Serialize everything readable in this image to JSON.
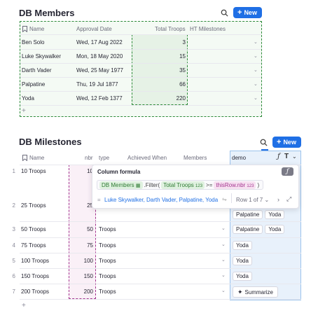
{
  "members": {
    "title": "DB Members",
    "new_label": "New",
    "columns": [
      "Name",
      "Approval Date",
      "Total Troops",
      "HT Milestones"
    ],
    "rows": [
      {
        "name": "Ben Solo",
        "date": "Wed, 17 Aug 2022",
        "troops": "3"
      },
      {
        "name": "Luke Skywalker",
        "date": "Mon, 18 May 2020",
        "troops": "15"
      },
      {
        "name": "Darth Vader",
        "date": "Wed, 25 May 1977",
        "troops": "35"
      },
      {
        "name": "Palpatine",
        "date": "Thu, 19 Jul 1877",
        "troops": "66"
      },
      {
        "name": "Yoda",
        "date": "Wed, 12 Feb 1377",
        "troops": "220"
      }
    ],
    "add_row": "+"
  },
  "milestones": {
    "title": "DB Milestones",
    "new_label": "New",
    "columns": [
      "Name",
      "nbr",
      "type",
      "Achieved When",
      "Members",
      "demo"
    ],
    "rows": [
      {
        "num": "1",
        "name": "10 Troops",
        "nbr": "10",
        "type": "",
        "demo": []
      },
      {
        "num": "2",
        "name": "25 Troops",
        "nbr": "25",
        "type": "",
        "demo": [
          "Palpatine",
          "Yoda"
        ]
      },
      {
        "num": "3",
        "name": "50 Troops",
        "nbr": "50",
        "type": "Troops",
        "demo": [
          "Palpatine",
          "Yoda"
        ]
      },
      {
        "num": "4",
        "name": "75 Troops",
        "nbr": "75",
        "type": "Troops",
        "demo": [
          "Yoda"
        ]
      },
      {
        "num": "5",
        "name": "100 Troops",
        "nbr": "100",
        "type": "Troops",
        "demo": [
          "Yoda"
        ]
      },
      {
        "num": "6",
        "name": "150 Troops",
        "nbr": "150",
        "type": "Troops",
        "demo": [
          "Yoda"
        ]
      },
      {
        "num": "7",
        "name": "200 Troops",
        "nbr": "200",
        "type": "Troops",
        "demo": []
      }
    ],
    "add_row": "+",
    "summarize_label": "Summarize"
  },
  "formula_popup": {
    "title": "Column formula",
    "table_ref": "DB Members",
    "method": ".Filter(",
    "field_ref": "Total Troops",
    "operator": ">=",
    "this_ref": "thisRow.nbr",
    "close_paren": ")",
    "result_text": "Luke Skywalker, Darth Vader, Palpatine, Yoda",
    "row_label": "Row 1 of 7",
    "result_prefix": "="
  },
  "colors": {
    "accent": "#1f6fe5",
    "member_highlight": "#2e8b3a",
    "nbr_highlight": "#a3348f",
    "demo_bg": "#e8f1fb"
  }
}
